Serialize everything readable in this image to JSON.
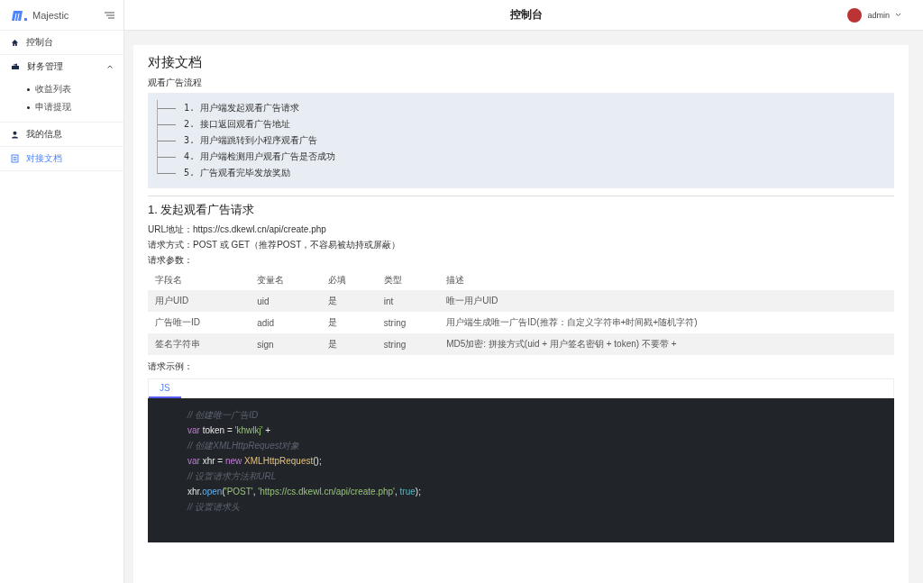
{
  "brand": {
    "name": "Majestic"
  },
  "sidebar": {
    "items": [
      {
        "label": "控制台",
        "selected": false
      },
      {
        "label": "财务管理",
        "selected": false,
        "expanded": true,
        "children": [
          {
            "label": "收益列表",
            "selected": false
          },
          {
            "label": "申请提现",
            "selected": false
          }
        ]
      },
      {
        "label": "我的信息",
        "selected": false
      },
      {
        "label": "对接文档",
        "selected": true
      }
    ]
  },
  "header": {
    "title": "控制台",
    "user": "admin"
  },
  "doc": {
    "title": "对接文档",
    "flow_title": "观看广告流程",
    "flow_steps": [
      "1. 用户端发起观看广告请求",
      "2. 接口返回观看广告地址",
      "3. 用户端跳转到小程序观看广告",
      "4. 用户端检测用户观看广告是否成功",
      "5. 广告观看完毕发放奖励"
    ],
    "section_title": "1. 发起观看广告请求",
    "info": [
      "URL地址：https://cs.dkewl.cn/api/create.php",
      "请求方式：POST 或 GET（推荐POST，不容易被劫持或屏蔽）",
      "请求参数："
    ],
    "table": {
      "columns": [
        "字段名",
        "变量名",
        "必填",
        "类型",
        "描述"
      ],
      "rows": [
        [
          "用户UID",
          "uid",
          "是",
          "int",
          "唯一用户UID"
        ],
        [
          "广告唯一ID",
          "adid",
          "是",
          "string",
          "用户端生成唯一广告ID(推荐：自定义字符串+时间戳+随机字符)"
        ],
        [
          "签名字符串",
          "sign",
          "是",
          "string",
          "MD5加密: 拼接方式(uid + 用户签名密钥 + token) 不要带 +"
        ]
      ]
    },
    "example_title": "请求示例：",
    "code_tabs": [
      {
        "label": "JS",
        "selected": true
      }
    ],
    "code_lines": [
      [
        {
          "kind": "comment",
          "text": "// 创建唯一广告ID"
        }
      ],
      [
        {
          "kind": "keyword",
          "text": "var"
        },
        {
          "kind": "plain",
          "text": " token = "
        },
        {
          "kind": "string",
          "text": "'khwlkj'"
        },
        {
          "kind": "plain",
          "text": " +"
        }
      ],
      [
        {
          "kind": "comment",
          "text": "// 创建XMLHttpRequest对象"
        }
      ],
      [
        {
          "kind": "keyword",
          "text": "var"
        },
        {
          "kind": "plain",
          "text": " xhr = "
        },
        {
          "kind": "keyword",
          "text": "new "
        },
        {
          "kind": "class",
          "text": "XMLHttpRequest"
        },
        {
          "kind": "plain",
          "text": "();"
        }
      ],
      [
        {
          "kind": "comment",
          "text": "// 设置请求方法和URL"
        }
      ],
      [
        {
          "kind": "plain",
          "text": "xhr."
        },
        {
          "kind": "func",
          "text": "open"
        },
        {
          "kind": "plain",
          "text": "("
        },
        {
          "kind": "string",
          "text": "'POST'"
        },
        {
          "kind": "plain",
          "text": ", "
        },
        {
          "kind": "string",
          "text": "'https://cs.dkewl.cn/api/create.php'"
        },
        {
          "kind": "plain",
          "text": ", "
        },
        {
          "kind": "literal",
          "text": "true"
        },
        {
          "kind": "plain",
          "text": ");"
        }
      ],
      [
        {
          "kind": "comment",
          "text": "// 设置请求头"
        }
      ]
    ]
  }
}
